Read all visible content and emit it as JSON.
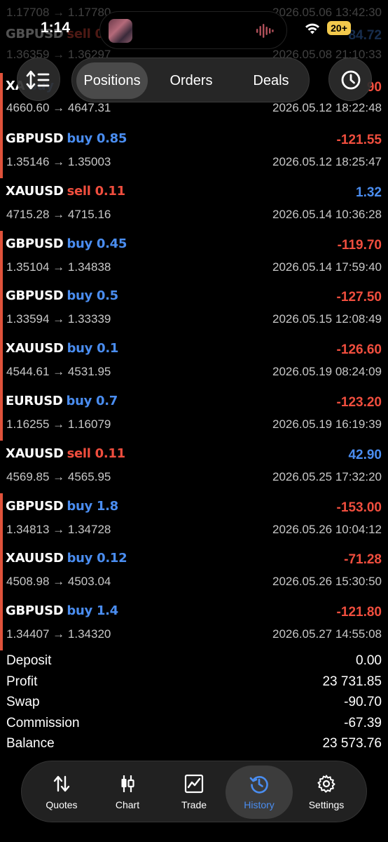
{
  "status_bar": {
    "time": "1:14",
    "battery": "20+"
  },
  "tabs": [
    {
      "label": "Positions",
      "active": true
    },
    {
      "label": "Orders",
      "active": false
    },
    {
      "label": "Deals",
      "active": false
    }
  ],
  "partial_rows": [
    {
      "prices": "1.17708 → 1.17780",
      "time": "2026.05.06 13:42:30"
    },
    {
      "symbol": "GBPUSD",
      "side": "sell",
      "volume": "0.5",
      "profit": "84.72",
      "prices": "1.36359 → 1.36297",
      "time": "2026.05.08 21:10:33"
    },
    {
      "symbol": "XA",
      "side": "buy",
      "volume": "",
      "profit": "90",
      "prices": "4660.60 → 4647.31",
      "time": "2026.05.12 18:22:48"
    }
  ],
  "deals": [
    {
      "symbol": "GBPUSD",
      "side": "buy",
      "volume": "0.85",
      "profit": "-121.55",
      "prices": "1.35146 → 1.35003",
      "time": "2026.05.12 18:25:47"
    },
    {
      "symbol": "XAUUSD",
      "side": "sell",
      "volume": "0.11",
      "profit": "1.32",
      "prices": "4715.28 → 4715.16",
      "time": "2026.05.14 10:36:28"
    },
    {
      "symbol": "GBPUSD",
      "side": "buy",
      "volume": "0.45",
      "profit": "-119.70",
      "prices": "1.35104 → 1.34838",
      "time": "2026.05.14 17:59:40"
    },
    {
      "symbol": "GBPUSD",
      "side": "buy",
      "volume": "0.5",
      "profit": "-127.50",
      "prices": "1.33594 → 1.33339",
      "time": "2026.05.15 12:08:49"
    },
    {
      "symbol": "XAUUSD",
      "side": "buy",
      "volume": "0.1",
      "profit": "-126.60",
      "prices": "4544.61 → 4531.95",
      "time": "2026.05.19 08:24:09"
    },
    {
      "symbol": "EURUSD",
      "side": "buy",
      "volume": "0.7",
      "profit": "-123.20",
      "prices": "1.16255 → 1.16079",
      "time": "2026.05.19 16:19:39"
    },
    {
      "symbol": "XAUUSD",
      "side": "sell",
      "volume": "0.11",
      "profit": "42.90",
      "prices": "4569.85 → 4565.95",
      "time": "2026.05.25 17:32:20"
    },
    {
      "symbol": "GBPUSD",
      "side": "buy",
      "volume": "1.8",
      "profit": "-153.00",
      "prices": "1.34813 → 1.34728",
      "time": "2026.05.26 10:04:12"
    },
    {
      "symbol": "XAUUSD",
      "side": "buy",
      "volume": "0.12",
      "profit": "-71.28",
      "prices": "4508.98 → 4503.04",
      "time": "2026.05.26 15:30:50"
    },
    {
      "symbol": "GBPUSD",
      "side": "buy",
      "volume": "1.4",
      "profit": "-121.80",
      "prices": "1.34407 → 1.34320",
      "time": "2026.05.27 14:55:08"
    }
  ],
  "summary": [
    {
      "label": "Deposit",
      "value": "0.00"
    },
    {
      "label": "Profit",
      "value": "23 731.85"
    },
    {
      "label": "Swap",
      "value": "-90.70"
    },
    {
      "label": "Commission",
      "value": "-67.39"
    },
    {
      "label": "Balance",
      "value": "23 573.76"
    }
  ],
  "bottom_nav": [
    {
      "label": "Quotes",
      "icon": "quotes-icon",
      "active": false
    },
    {
      "label": "Chart",
      "icon": "candlestick-icon",
      "active": false
    },
    {
      "label": "Trade",
      "icon": "trade-chart-icon",
      "active": false
    },
    {
      "label": "History",
      "icon": "history-icon",
      "active": true
    },
    {
      "label": "Settings",
      "icon": "gear-icon",
      "active": false
    }
  ],
  "colors": {
    "buy": "#4a8df0",
    "sell": "#f04e3e",
    "profit_positive": "#4a8df0",
    "profit_negative": "#f04e3e",
    "accent_bar": "#e0523a"
  }
}
